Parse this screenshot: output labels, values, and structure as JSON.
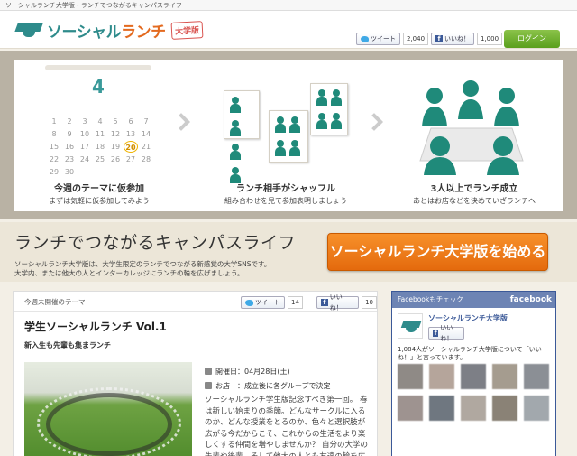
{
  "topbar": {
    "text": "ソーシャルランチ大学版・ランチでつながるキャンパスライフ"
  },
  "header": {
    "logo_main": "ソーシャル",
    "logo_accent": "ランチ",
    "logo_badge": "大学版",
    "tweet_label": "ツイート",
    "tweet_count": "2,040",
    "like_label": "いいね！",
    "like_count": "1,000",
    "login_label": "ログイン"
  },
  "hero": {
    "calendar_month": "4",
    "calendar_days": [
      "",
      "",
      "",
      "",
      "",
      "",
      "",
      "1",
      "2",
      "3",
      "4",
      "5",
      "6",
      "7",
      "8",
      "9",
      "10",
      "11",
      "12",
      "13",
      "14",
      "15",
      "16",
      "17",
      "18",
      "19",
      "20",
      "21",
      "22",
      "23",
      "24",
      "25",
      "26",
      "27",
      "28",
      "29",
      "30"
    ],
    "highlight_day": "20",
    "steps": [
      {
        "title": "今週のテーマに仮参加",
        "sub": "まずは気軽に仮参加してみよう"
      },
      {
        "title": "ランチ相手がシャッフル",
        "sub": "組み合わせを見て参加表明しましょう"
      },
      {
        "title": "3人以上でランチ成立",
        "sub": "あとはお店などを決めていざランチへ"
      }
    ]
  },
  "band": {
    "title": "ランチでつながるキャンパスライフ",
    "desc_line1": "ソーシャルランチ大学版は、大学生限定のランチでつながる新感覚の大学SNSです。",
    "desc_line2": "大学内、または他大の人とインターカレッジにランチの輪を広げましょう。",
    "cta_label": "ソーシャルランチ大学版を始める"
  },
  "main": {
    "label": "今週未開催のテーマ",
    "tweet_label": "ツイート",
    "tweet_count": "14",
    "like_label": "いいね！",
    "like_count": "10",
    "article_title": "学生ソーシャルランチ Vol.1",
    "article_sub": "新入生も先輩も集まランチ",
    "date_label": "開催日：04月28日(土)",
    "place_label": "お店　：成立後に各グループで決定",
    "body": "ソーシャルランチ学生版記念すべき第一回。 春は新しい始まりの季節。どんなサークルに入るのか、どんな授業をとるのか、色々と選択肢が広がる今だからこそ、これからの生活をより楽しくする仲間を増やしませんか？ 自分の大学の先輩や後輩、そして他大の人とも友達の輪を広"
  },
  "facebook": {
    "header": "Facebookもチェック",
    "brand": "facebook",
    "page_name": "ソーシャルランチ大学版",
    "like_label": "いいね！",
    "count_text": "1,084人がソーシャルランチ大学版について「いいね！」と言っています。"
  },
  "colors": {
    "teal": "#2e8b8b",
    "orange": "#e36a1f",
    "cta": "#f7902a",
    "fb": "#3b5998"
  }
}
